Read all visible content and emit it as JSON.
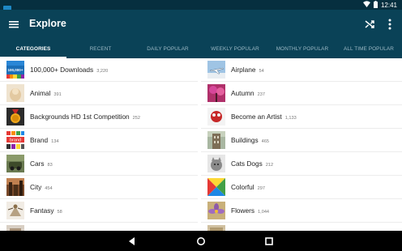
{
  "status_bar": {
    "time": "12:41"
  },
  "app_bar": {
    "title": "Explore"
  },
  "tabs": [
    {
      "label": "CATEGORIES"
    },
    {
      "label": "RECENT"
    },
    {
      "label": "DAILY POPULAR"
    },
    {
      "label": "WEEKLY POPULAR"
    },
    {
      "label": "MONTHLY POPULAR"
    },
    {
      "label": "ALL TIME POPULAR"
    }
  ],
  "categories_left": [
    {
      "name": "100,000+ Downloads",
      "count": "3,220"
    },
    {
      "name": "Animal",
      "count": "391"
    },
    {
      "name": "Backgrounds HD 1st Competition",
      "count": "252"
    },
    {
      "name": "Brand",
      "count": "134"
    },
    {
      "name": "Cars",
      "count": "83"
    },
    {
      "name": "City",
      "count": "454"
    },
    {
      "name": "Fantasy",
      "count": "58"
    },
    {
      "name": "",
      "count": ""
    }
  ],
  "categories_right": [
    {
      "name": "Airplane",
      "count": "54"
    },
    {
      "name": "Autumn",
      "count": "237"
    },
    {
      "name": "Become an Artist",
      "count": "1,133"
    },
    {
      "name": "Buildings",
      "count": "465"
    },
    {
      "name": "Cats Dogs",
      "count": "212"
    },
    {
      "name": "Colorful",
      "count": "297"
    },
    {
      "name": "Flowers",
      "count": "1,044"
    },
    {
      "name": "",
      "count": ""
    }
  ],
  "thumb_labels": {
    "downloads": "100,000+",
    "brand": "brand"
  },
  "colors": {
    "app_bar": "#0a4257",
    "status_bar": "#062f3f",
    "tab_inactive": "#9bb8c4"
  }
}
